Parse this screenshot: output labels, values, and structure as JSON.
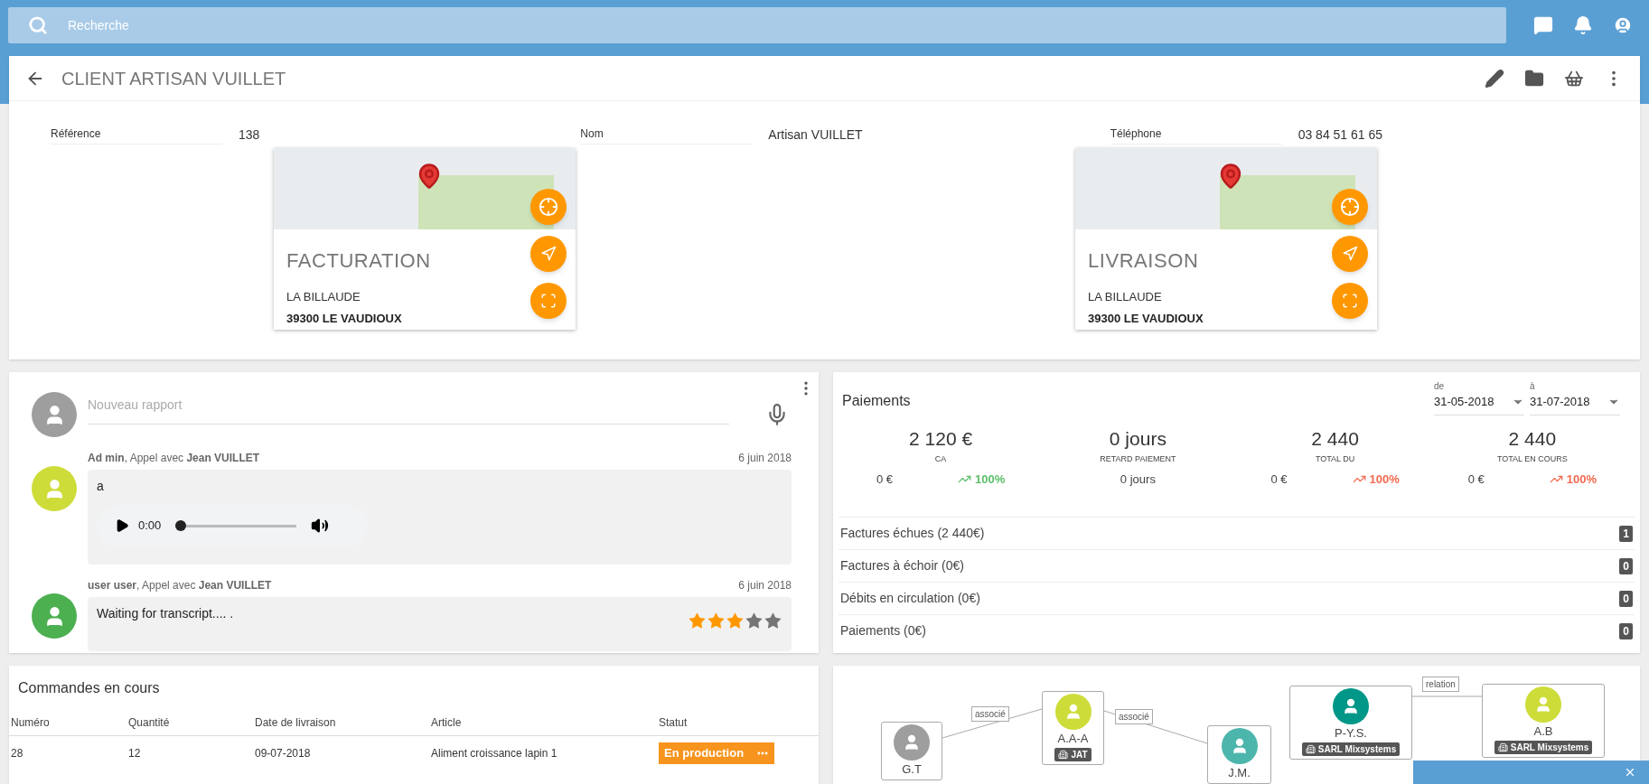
{
  "search": {
    "placeholder": "Recherche"
  },
  "header": {
    "title": "CLIENT ARTISAN VUILLET"
  },
  "fields": [
    {
      "label": "Référence",
      "value": "138"
    },
    {
      "label": "Nom",
      "value": "Artisan VUILLET"
    },
    {
      "label": "Téléphone",
      "value": "03 84 51 61 65"
    }
  ],
  "addresses": [
    {
      "title": "FACTURATION",
      "line_1": "LA BILLAUDE",
      "line_2": "39300 LE VAUDIOUX"
    },
    {
      "title": "LIVRAISON",
      "line_1": "LA BILLAUDE",
      "line_2": "39300 LE VAUDIOUX"
    }
  ],
  "reports": {
    "new_report": {
      "placeholder": "Nouveau rapport"
    },
    "entries": [
      {
        "kind": "audio",
        "author": "**Ad min**, Appel avec **Jean VUILLET**",
        "date": "6 juin 2018",
        "color": "#cddc39",
        "text": "a",
        "audio": {
          "time": "0:00",
          "level": 0
        }
      },
      {
        "kind": "transcript",
        "author": "**user user**, Appel avec **Jean VUILLET**",
        "date": "6 juin 2018",
        "color": "#4caf50",
        "text": "Waiting for transcript.... .",
        "stars": 3
      }
    ]
  },
  "payments": {
    "title": "Paiements",
    "date_from": {
      "label": "de",
      "value": "31-05-2018"
    },
    "date_to": {
      "label": "à",
      "value": "31-07-2018"
    },
    "stats": [
      {
        "value": "2 120 €",
        "label": "CA",
        "sub_value": "0 €",
        "trend": "100%",
        "color": "#5cbf6a"
      },
      {
        "value": "0 jours",
        "label": "RETARD PAIEMENT",
        "sub_value": "0 jours"
      },
      {
        "value": "2 440",
        "label": "TOTAL DU",
        "sub_value": "0 €",
        "trend": "100%",
        "color": "#f26b50"
      },
      {
        "value": "2 440",
        "label": "TOTAL EN COURS",
        "sub_value": "0 €",
        "trend": "100%",
        "color": "#f26b50"
      }
    ],
    "items": [
      {
        "label": "Factures échues (2 440€)",
        "count": "1"
      },
      {
        "label": "Factures à échoir (0€)",
        "count": "0"
      },
      {
        "label": "Débits en circulation (0€)",
        "count": "0"
      },
      {
        "label": "Paiements (0€)",
        "count": "0"
      }
    ]
  },
  "orders": {
    "title": "Commandes en cours",
    "columns": [
      "Numéro",
      "Quantité",
      "Date de livraison",
      "Article",
      "Statut"
    ],
    "rows": [
      {
        "cells": [
          "28",
          "12",
          "09-07-2018",
          "Aliment croissance lapin 1"
        ],
        "status": "En production"
      }
    ]
  },
  "relations": {
    "nodes": [
      {
        "name": "G.T",
        "color": "#9e9e9e"
      },
      {
        "name": "A.A-A",
        "color": "#cddc39",
        "company": "JAT"
      },
      {
        "name": "J.M.",
        "color": "#4db6ac"
      },
      {
        "name": "P-Y.S.",
        "color": "#009688",
        "company": "SARL Mixsystems"
      },
      {
        "name": "A.B",
        "color": "#cddc39",
        "company": "SARL Mixsystems"
      }
    ],
    "edges": [
      {
        "label": "associé"
      },
      {
        "label": "associé"
      },
      {
        "label": "relation"
      }
    ]
  }
}
